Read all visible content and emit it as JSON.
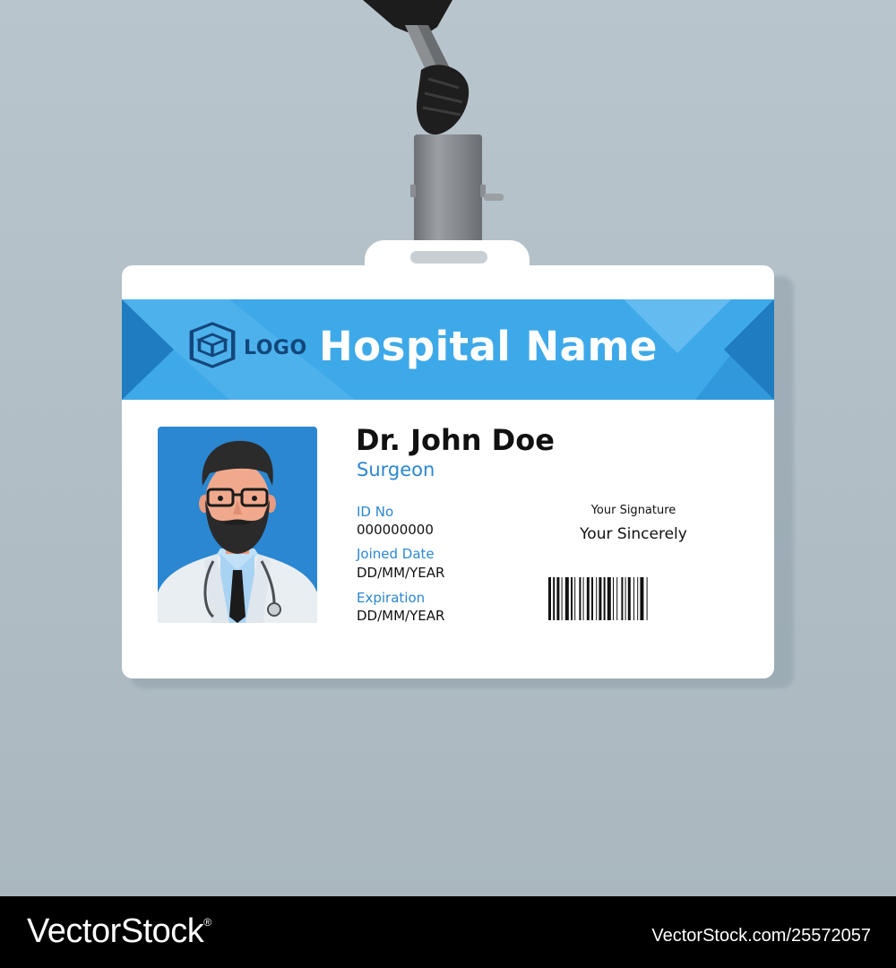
{
  "card": {
    "hospital_name": "Hospital Name",
    "logo_text": "LOGO",
    "person_name": "Dr. John Doe",
    "person_title": "Surgeon",
    "fields": [
      {
        "label": "ID No",
        "value": "000000000"
      },
      {
        "label": "Joined Date",
        "value": "DD/MM/YEAR"
      },
      {
        "label": "Expiration",
        "value": "DD/MM/YEAR"
      }
    ],
    "signature_label": "Your Signature",
    "signature_value": "Your Sincerely"
  },
  "colors": {
    "band_blue": "#3ea9e8",
    "band_dark": "#1f7cc0",
    "photo_bg": "#2b87d1",
    "label_blue": "#2b87d1",
    "background": "#b9c5cd"
  },
  "icons": {
    "logo": "hexagon-cube-icon",
    "photo": "doctor-avatar-icon",
    "barcode": "barcode-icon"
  },
  "footer": {
    "brand": "VectorStock",
    "brand_mark": "®",
    "asset_id": "VectorStock.com/25572057"
  }
}
